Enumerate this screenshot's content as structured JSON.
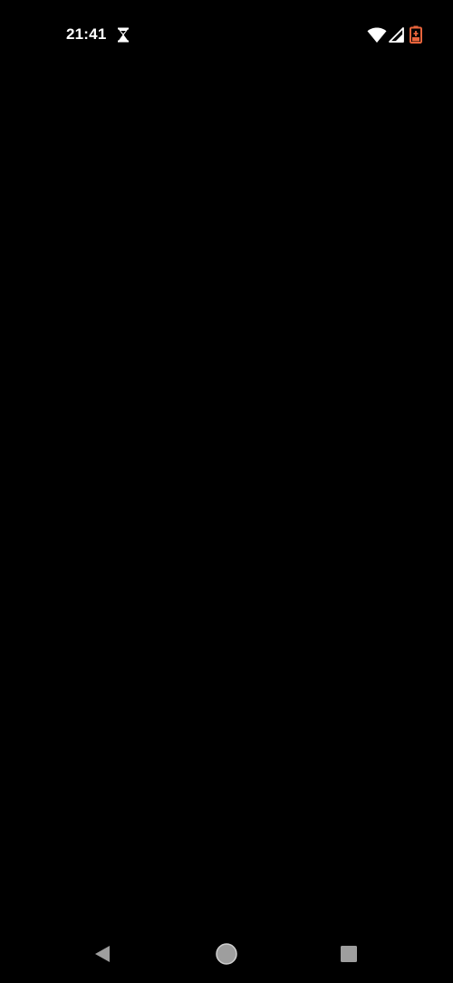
{
  "status_bar": {
    "time": "21:41",
    "icons": [
      "hourglass-icon",
      "wifi-icon",
      "signal-icon",
      "battery-charging-icon"
    ],
    "battery_color": "#e8643c"
  },
  "screen": {
    "background": "#000000"
  },
  "nav_bar": {
    "buttons": [
      "back-button",
      "home-button",
      "recents-button"
    ],
    "icon_color": "#9e9e9e"
  }
}
